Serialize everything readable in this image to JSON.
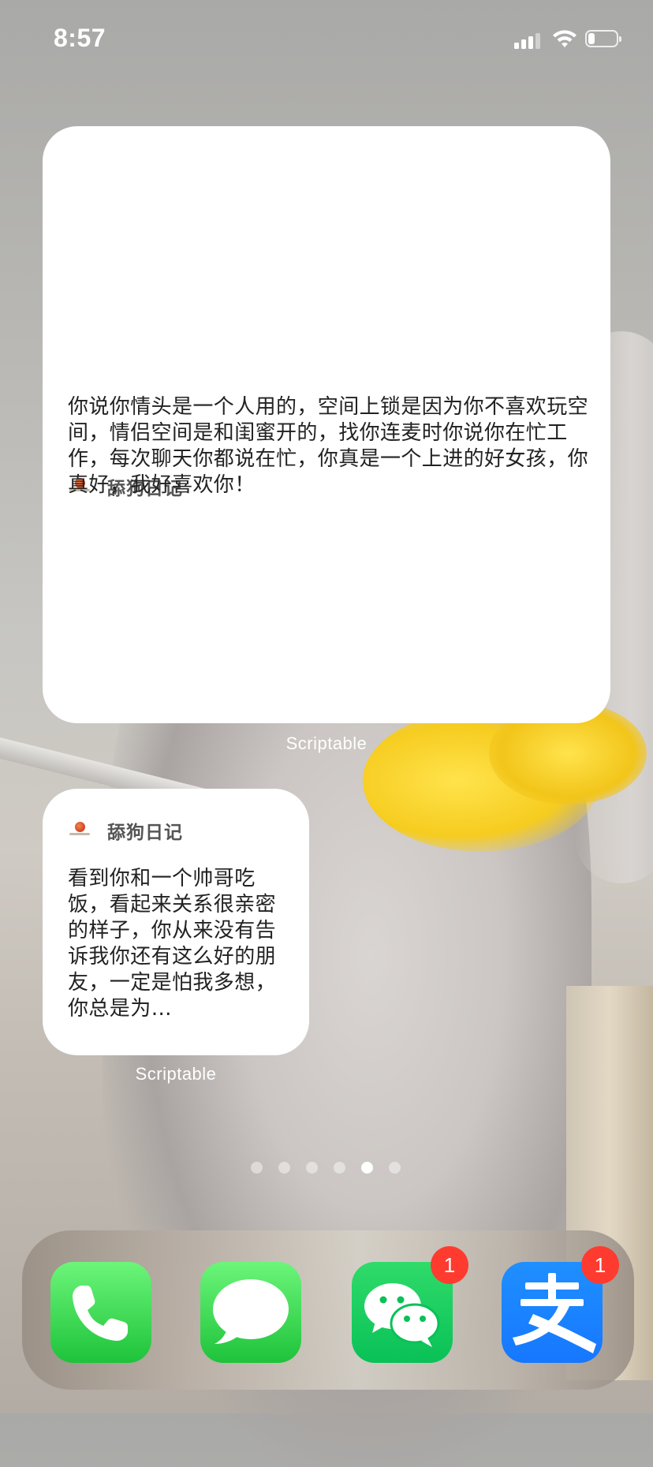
{
  "status_bar": {
    "time": "8:57"
  },
  "widgets": {
    "large": {
      "title": "舔狗日记",
      "text": "你说你情头是一个人用的，空间上锁是因为你不喜欢玩空间，情侣空间是和闺蜜开的，找你连麦时你说你在忙工作，每次聊天你都说在忙，你真是一个上进的好女孩，你真好，我好喜欢你！",
      "app_label": "Scriptable"
    },
    "small": {
      "title": "舔狗日记",
      "text": "看到你和一个帅哥吃饭，看起来关系很亲密的样子，你从来没有告诉我你还有这么好的朋友，一定是怕我多想，你总是为…",
      "app_label": "Scriptable"
    }
  },
  "page_indicator": {
    "total": 6,
    "active_index": 4
  },
  "dock": {
    "apps": [
      {
        "name": "Phone",
        "icon": "phone-icon"
      },
      {
        "name": "Messages",
        "icon": "messages-icon"
      },
      {
        "name": "WeChat",
        "icon": "wechat-icon",
        "badge": "1"
      },
      {
        "name": "Alipay",
        "icon": "alipay-icon",
        "badge": "1"
      }
    ]
  }
}
